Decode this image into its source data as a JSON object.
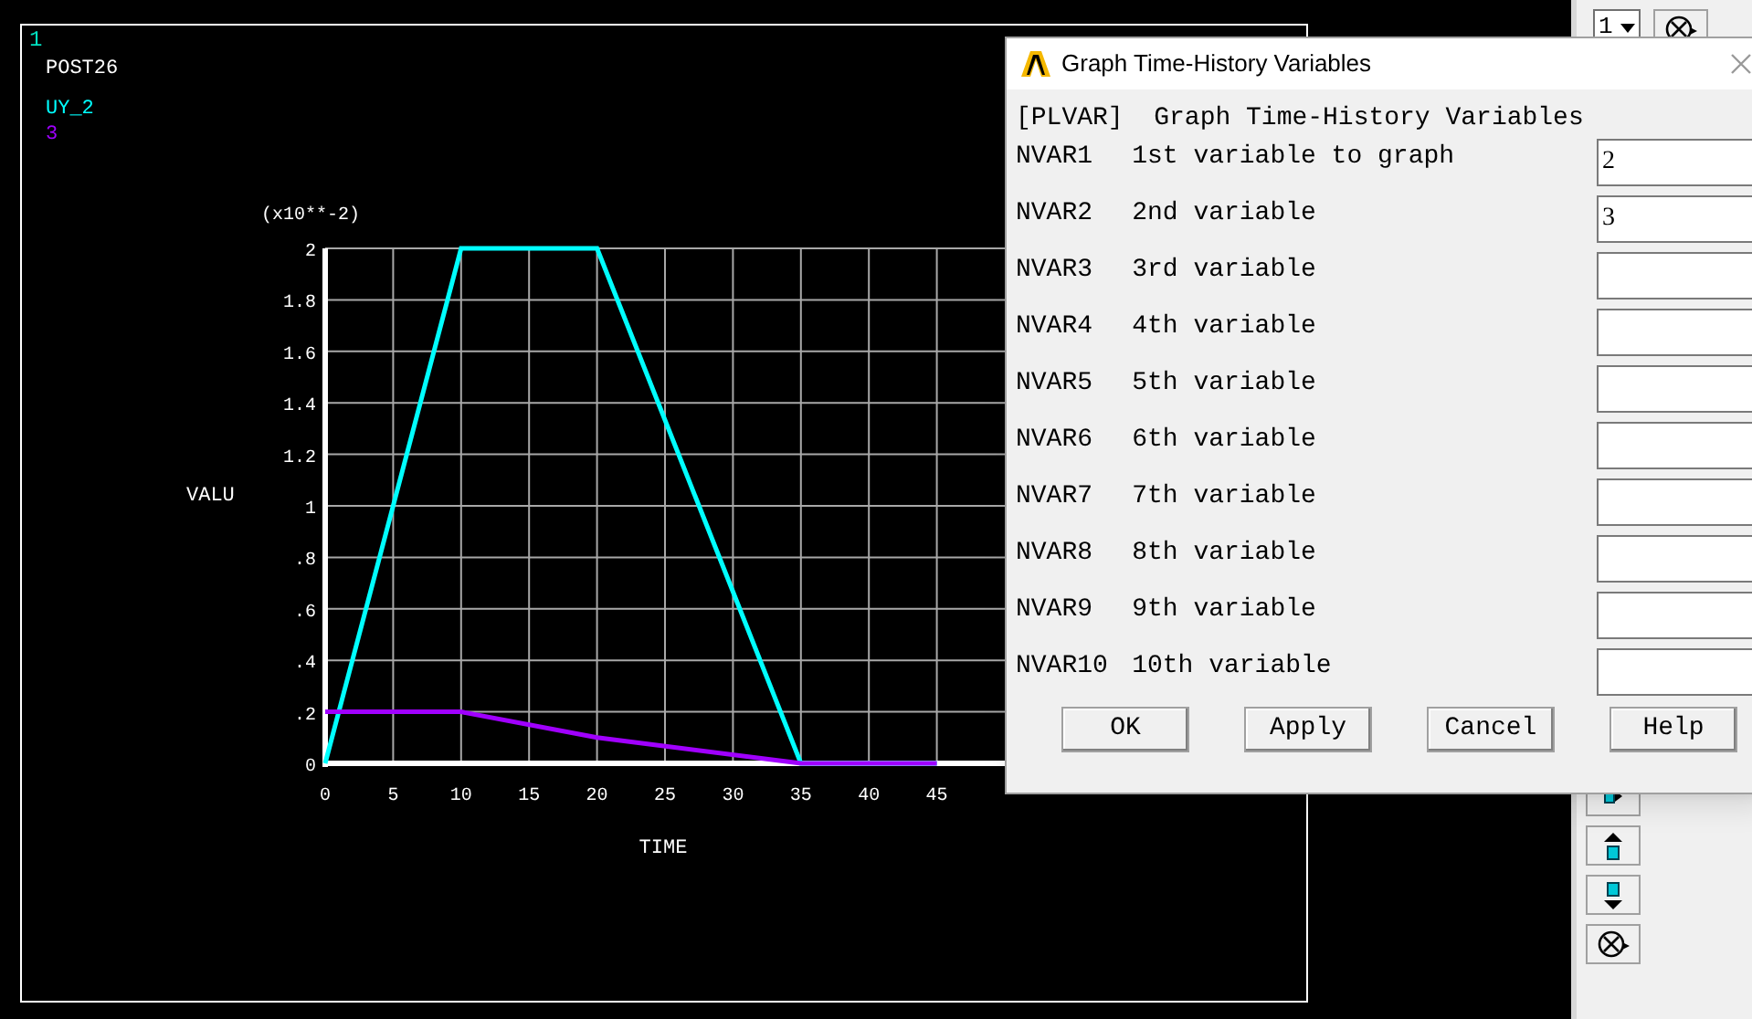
{
  "graphics": {
    "window_number": "1",
    "title": "POST26",
    "chart_data": {
      "type": "line",
      "xlabel": "TIME",
      "ylabel": "VALU",
      "annotations": [
        "(x10**-2)"
      ],
      "x": [
        0,
        10,
        20,
        35,
        45
      ],
      "series": [
        {
          "name": "UY_2",
          "color": "#00ffff",
          "values": [
            0,
            2,
            2,
            0,
            0
          ]
        },
        {
          "name": "3",
          "color": "#a000ff",
          "values": [
            0.2,
            0.2,
            0.1,
            0,
            0
          ]
        }
      ],
      "grid": true,
      "xlim": [
        0,
        50
      ],
      "ylim": [
        0,
        2
      ],
      "xticks": [
        0,
        5,
        10,
        15,
        20,
        25,
        30,
        35,
        40,
        45
      ],
      "yticks": [
        0,
        {
          "value": 0.2,
          "label": ".2"
        },
        {
          "value": 0.4,
          "label": ".4"
        },
        {
          "value": 0.6,
          "label": ".6"
        },
        {
          "value": 0.8,
          "label": ".8"
        },
        1,
        1.2,
        1.4,
        1.6,
        1.8,
        2
      ]
    }
  },
  "toolbar": {
    "window_select": "1"
  },
  "dialog": {
    "title": "Graph Time-History Variables",
    "heading": "[PLVAR]  Graph Time-History Variables",
    "fields": [
      {
        "name": "NVAR1",
        "label": "1st variable to graph",
        "value": "2"
      },
      {
        "name": "NVAR2",
        "label": "2nd variable",
        "value": "3"
      },
      {
        "name": "NVAR3",
        "label": "3rd variable"
      },
      {
        "name": "NVAR4",
        "label": "4th variable"
      },
      {
        "name": "NVAR5",
        "label": "5th variable"
      },
      {
        "name": "NVAR6",
        "label": "6th variable"
      },
      {
        "name": "NVAR7",
        "label": "7th variable"
      },
      {
        "name": "NVAR8",
        "label": "8th variable"
      },
      {
        "name": "NVAR9",
        "label": "9th variable"
      },
      {
        "name": "NVAR10",
        "label": "10th variable"
      }
    ],
    "buttons": [
      "OK",
      "Apply",
      "Cancel",
      "Help"
    ]
  }
}
